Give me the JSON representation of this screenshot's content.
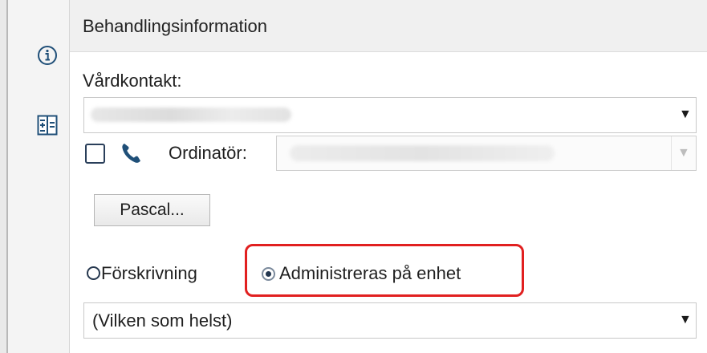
{
  "panel": {
    "title": "Behandlingsinformation"
  },
  "rail": {
    "icons": [
      "info-icon",
      "form-layout-icon"
    ]
  },
  "vardkontakt": {
    "label": "Vårdkontakt:",
    "value": ""
  },
  "ordinator": {
    "label": "Ordinatör:",
    "value": "",
    "telephone_checkbox_checked": false,
    "phone_icon": "phone-icon"
  },
  "pascal_button": {
    "label": "Pascal..."
  },
  "delivery": {
    "options": [
      {
        "label": "Förskrivning",
        "selected": false
      },
      {
        "label": "Administreras på enhet",
        "selected": true
      }
    ],
    "selected_option": "Administreras på enhet"
  },
  "unit_select": {
    "value": "(Vilken som helst)"
  },
  "colors": {
    "highlight": "#e12020",
    "icon_blue": "#1f4f78",
    "radio": "#26384f"
  }
}
